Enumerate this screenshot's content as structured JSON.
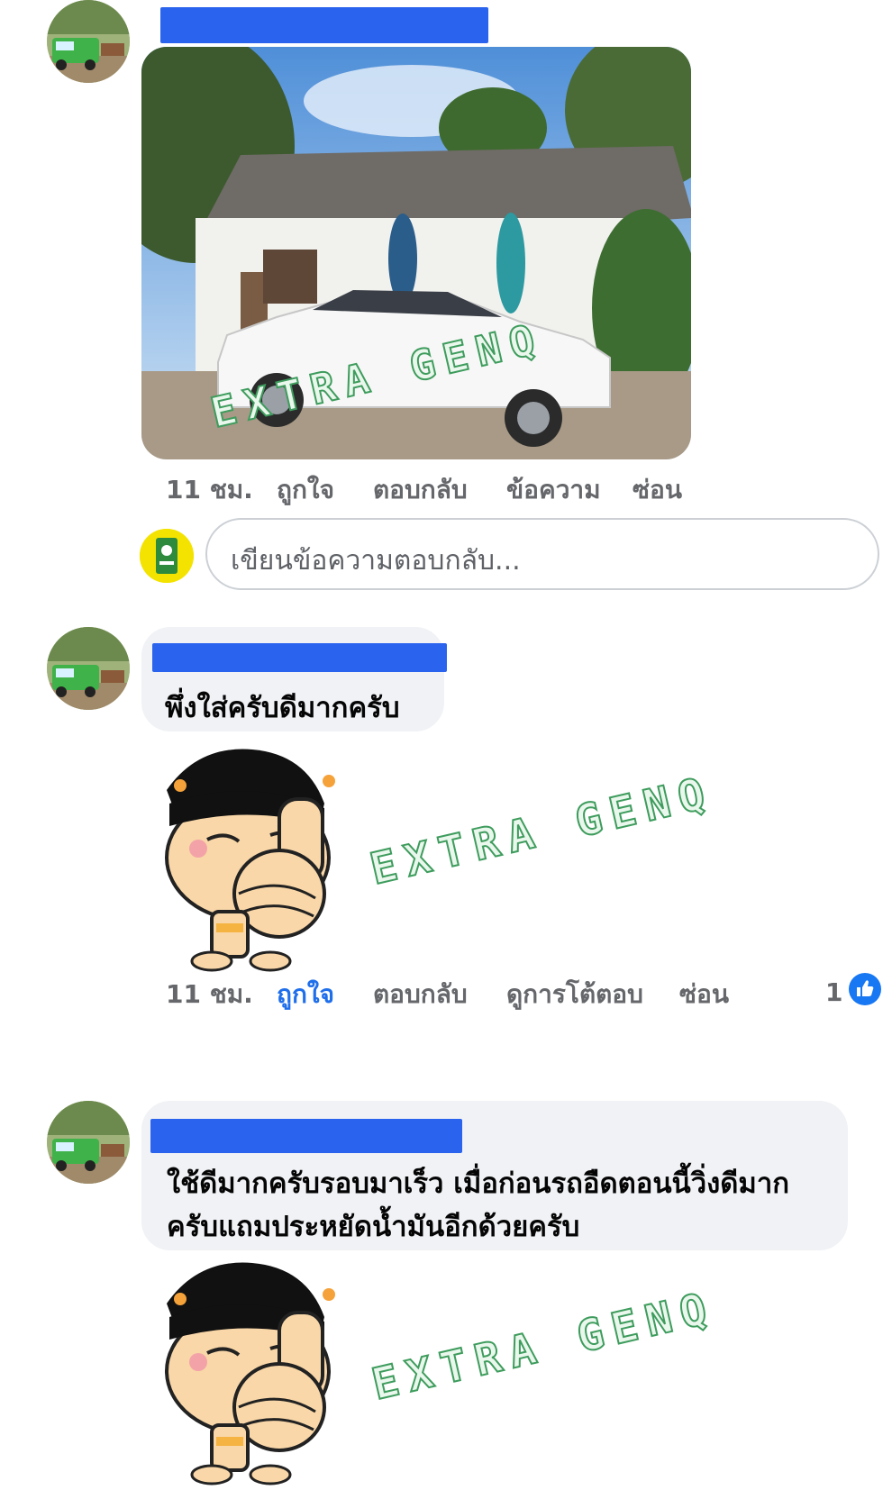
{
  "comments": [
    {
      "author_redacted": true,
      "photo_watermark": "EXTRA GENQ",
      "meta": {
        "time": "11 ชม.",
        "like": "ถูกใจ",
        "reply": "ตอบกลับ",
        "message": "ข้อความ",
        "hide": "ซ่อน"
      }
    },
    {
      "author_redacted": true,
      "text": "พึ่งใส่ครับดีมากครับ",
      "sticker_watermark": "EXTRA GENQ",
      "meta": {
        "time": "11 ชม.",
        "like": "ถูกใจ",
        "reply": "ตอบกลับ",
        "view_replies": "ดูการโต้ตอบ",
        "hide": "ซ่อน"
      },
      "like_count": "1",
      "liked": true
    },
    {
      "author_redacted": true,
      "text_line1": "ใช้ดีมากครับรอบมาเร็ว เมื่อก่อนรถอืดตอนนี้วิ่งดีมาก",
      "text_line2": "ครับแถมประหยัดน้ำมันอีกด้วยครับ",
      "sticker_watermark": "EXTRA GENQ"
    }
  ],
  "reply_composer": {
    "placeholder": "เขียนข้อความตอบกลับ..."
  },
  "colors": {
    "redaction": "#2a63ee",
    "liked": "#1f6feb",
    "bubble": "#f0f2f5",
    "watermark_stroke": "#3e9c5d"
  },
  "icons": {
    "like_reaction": "thumbs-up-icon"
  }
}
